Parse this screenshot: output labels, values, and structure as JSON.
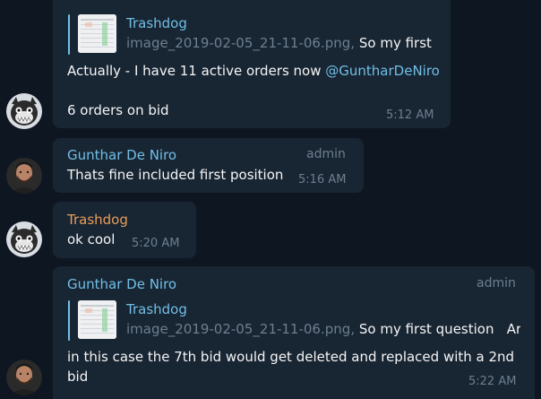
{
  "messages": [
    {
      "sender": "Trashdog",
      "reply": {
        "name": "Trashdog",
        "file": "image_2019-02-05_21-11-06.png,",
        "snippet": "So my first ..."
      },
      "text_prefix": "Actually - I have 11 active orders now",
      "mention": "@GuntharDeNiro",
      "text2": "6 orders on bid",
      "time": "5:12 AM"
    },
    {
      "sender": "Gunthar De Niro",
      "badge": "admin",
      "text": "Thats fine included first position",
      "time": "5:16 AM"
    },
    {
      "sender": "Trashdog",
      "text": "ok cool",
      "time": "5:20 AM"
    },
    {
      "sender": "Gunthar De Niro",
      "badge": "admin",
      "reply": {
        "name": "Trashdog",
        "file": "image_2019-02-05_21-11-06.png,",
        "snippet": "So my first question   Ar..."
      },
      "text_line1": "in this case the 7th bid would get deleted and replaced with a 2nd",
      "text_line2": "bid",
      "time": "5:22 AM"
    }
  ],
  "colors": {
    "background": "#0e1621",
    "bubble": "#182533",
    "accent_blue": "#71bfe6",
    "accent_orange": "#e99d58",
    "muted": "#6d7f8f"
  }
}
